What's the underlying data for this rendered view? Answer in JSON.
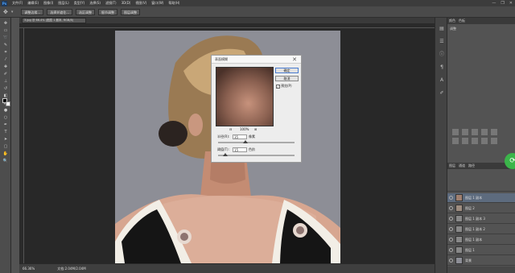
{
  "app": {
    "logo": "Ps"
  },
  "menu": [
    "文件(F)",
    "编辑(E)",
    "图像(I)",
    "图层(L)",
    "类型(Y)",
    "选择(S)",
    "滤镜(T)",
    "3D(D)",
    "视图(V)",
    "窗口(W)",
    "帮助(H)"
  ],
  "window_controls": [
    "—",
    "❐",
    "✕"
  ],
  "options_bar": [
    "调整边缘...",
    "选择并遮住...",
    "选区调整",
    "细节调整",
    "图层调整"
  ],
  "document_tab": {
    "title": "3.jpg @ 66.4% (图层 1 副本, RGB/8)"
  },
  "statusbar": {
    "zoom": "66.36%",
    "info": "文档:2.04M/2.04M"
  },
  "right_panel": {
    "tabs": [
      "颜色",
      "色板"
    ],
    "sub_label": "调整",
    "layers_tabs": [
      "图层",
      "通道",
      "路径"
    ],
    "layers": [
      {
        "name": "图层 1 副本"
      },
      {
        "name": "图层 2"
      },
      {
        "name": "图层 1 副本 3"
      },
      {
        "name": "图层 1 副本 2"
      },
      {
        "name": "图层 1 副本"
      },
      {
        "name": "图层 1"
      },
      {
        "name": "背景"
      }
    ]
  },
  "dialog": {
    "title": "表面模糊",
    "close": "✕",
    "ok": "确定",
    "cancel": "取消",
    "preview_label": "预览(P)",
    "zoom_minus": "⊟",
    "zoom_value": "100%",
    "zoom_plus": "⊞",
    "radius_label": "半径(R):",
    "radius_value": "35",
    "radius_unit": "像素",
    "threshold_label": "阈值(T):",
    "threshold_value": "15",
    "threshold_unit": "色阶"
  },
  "badge": {
    "label": "⟳"
  },
  "colors": {
    "accent": "#3bb54a",
    "chrome_dark": "#3c3c3c",
    "workspace": "#282828",
    "photo_bg": "#8d8e96"
  }
}
